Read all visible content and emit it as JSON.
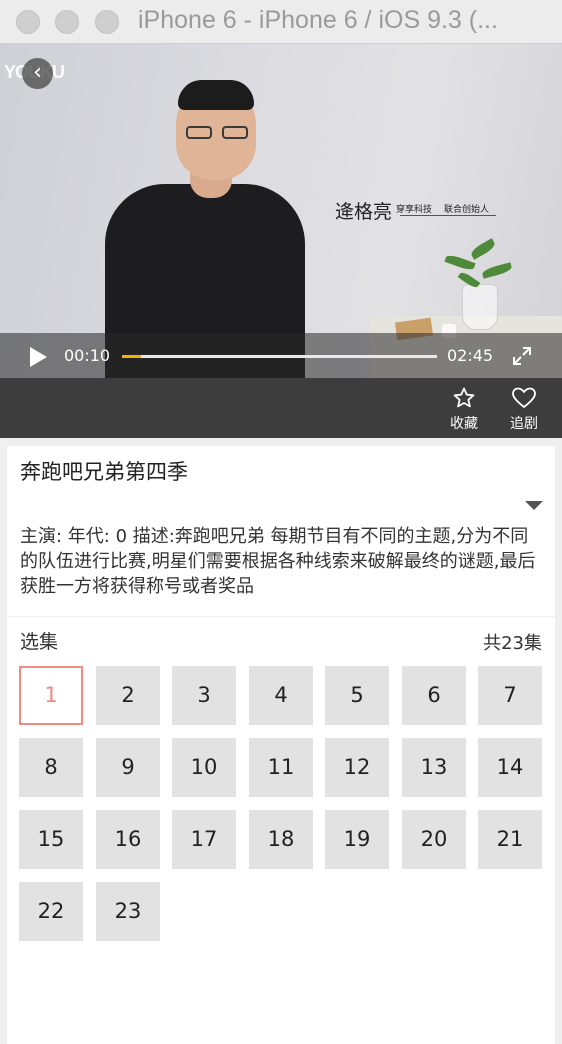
{
  "window": {
    "title": "iPhone 6 - iPhone 6 / iOS 9.3 (..."
  },
  "player": {
    "logo": "YOUKU",
    "caption": {
      "name": "逄格亮",
      "company": "穿享科技",
      "role": "联合创始人"
    },
    "current_time": "00:10",
    "total_time": "02:45",
    "progress": 0.06
  },
  "actions": [
    {
      "label": "收藏",
      "icon": "star-icon"
    },
    {
      "label": "追剧",
      "icon": "heart-icon"
    }
  ],
  "show": {
    "title": "奔跑吧兄弟第四季",
    "description": "主演: 年代: 0 描述:奔跑吧兄弟 每期节目有不同的主题,分为不同的队伍进行比赛,明星们需要根据各种线索来破解最终的谜题,最后获胜一方将获得称号或者奖品"
  },
  "episodes": {
    "label": "选集",
    "total": "共23集",
    "selected": "1",
    "items": [
      "1",
      "2",
      "3",
      "4",
      "5",
      "6",
      "7",
      "8",
      "9",
      "10",
      "11",
      "12",
      "13",
      "14",
      "15",
      "16",
      "17",
      "18",
      "19",
      "20",
      "21",
      "22",
      "23"
    ]
  },
  "colors": {
    "accent": "#f08a84",
    "progress": "#f5b300",
    "action_bar": "#3d3d3d"
  }
}
